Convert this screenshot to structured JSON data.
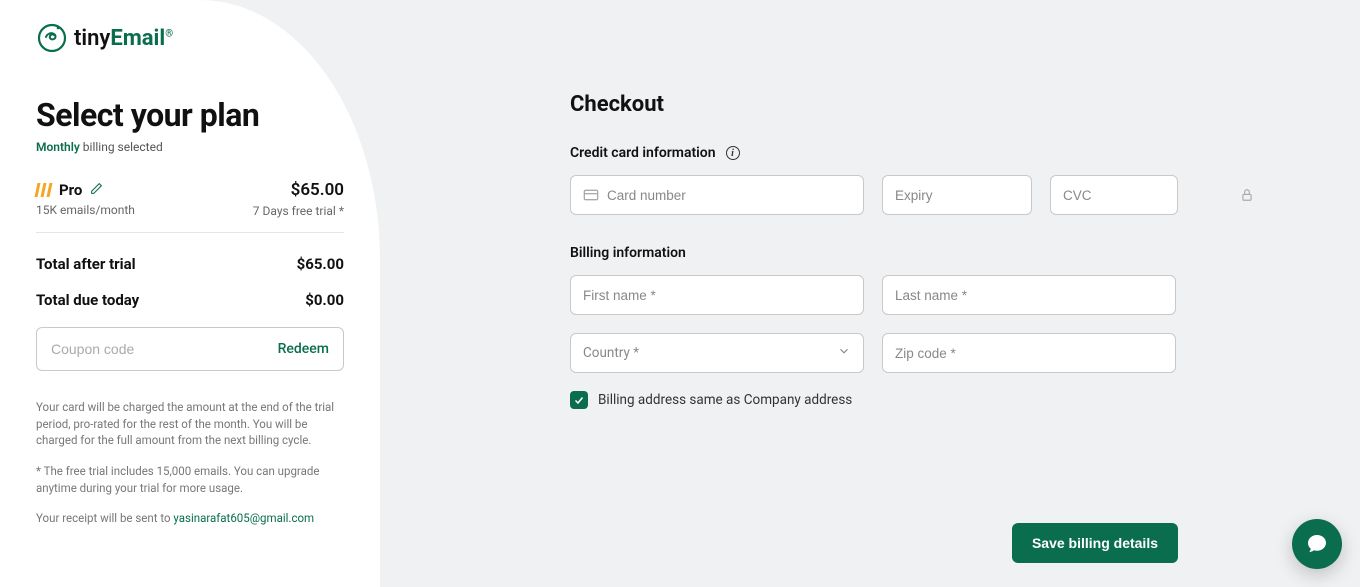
{
  "brand": {
    "tiny": "tiny",
    "email": "Email"
  },
  "sidebar": {
    "heading": "Select your plan",
    "billing_word": "Monthly",
    "billing_rest": " billing selected",
    "plan": {
      "name": "Pro",
      "subtitle": "15K emails/month",
      "price": "$65.00",
      "trial": "7 Days free trial *"
    },
    "totals": {
      "after_trial_label": "Total after trial",
      "after_trial_value": "$65.00",
      "due_today_label": "Total due today",
      "due_today_value": "$0.00"
    },
    "coupon": {
      "placeholder": "Coupon code",
      "redeem": "Redeem"
    },
    "note1": "Your card will be charged the amount at the end of the trial period, pro-rated for the rest of the month. You will be charged for the full amount from the next billing cycle.",
    "note2": "* The free trial includes 15,000 emails. You can upgrade anytime during your trial for more usage.",
    "receipt_prefix": "Your receipt will be sent to ",
    "receipt_email": "yasinarafat605@gmail.com"
  },
  "checkout": {
    "heading": "Checkout",
    "cc_label": "Credit card information",
    "card_placeholder": "Card number",
    "expiry_placeholder": "Expiry",
    "cvc_placeholder": "CVC",
    "billing_label": "Billing information",
    "first_name_placeholder": "First name *",
    "last_name_placeholder": "Last name *",
    "country_placeholder": "Country *",
    "zip_placeholder": "Zip code *",
    "same_address_label": "Billing address same as Company address",
    "save_button": "Save billing details"
  }
}
